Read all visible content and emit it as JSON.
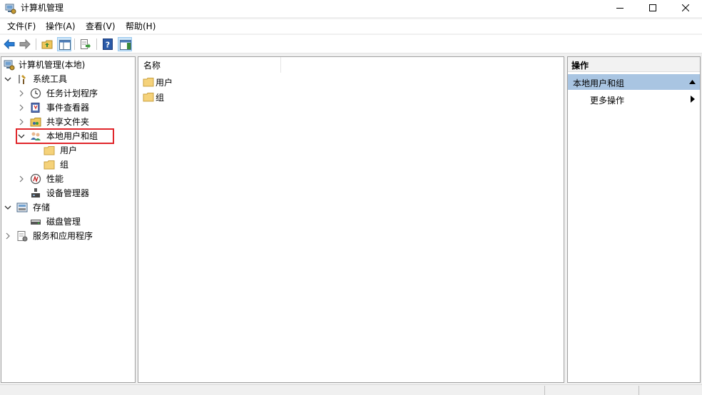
{
  "window": {
    "title": "计算机管理"
  },
  "menu": [
    "文件(F)",
    "操作(A)",
    "查看(V)",
    "帮助(H)"
  ],
  "tree": {
    "root": "计算机管理(本地)",
    "system_tools": "系统工具",
    "task_scheduler": "任务计划程序",
    "event_viewer": "事件查看器",
    "shared_folders": "共享文件夹",
    "local_users_groups": "本地用户和组",
    "users": "用户",
    "groups": "组",
    "performance": "性能",
    "device_manager": "设备管理器",
    "storage": "存储",
    "disk_management": "磁盘管理",
    "services_apps": "服务和应用程序"
  },
  "list": {
    "column_name": "名称",
    "items": [
      "用户",
      "组"
    ]
  },
  "actions": {
    "header": "操作",
    "group": "本地用户和组",
    "more": "更多操作"
  },
  "colors": {
    "selection_highlight": "#e0262b",
    "action_group_bg": "#a9c5e2",
    "folder": "#f5d27a"
  }
}
